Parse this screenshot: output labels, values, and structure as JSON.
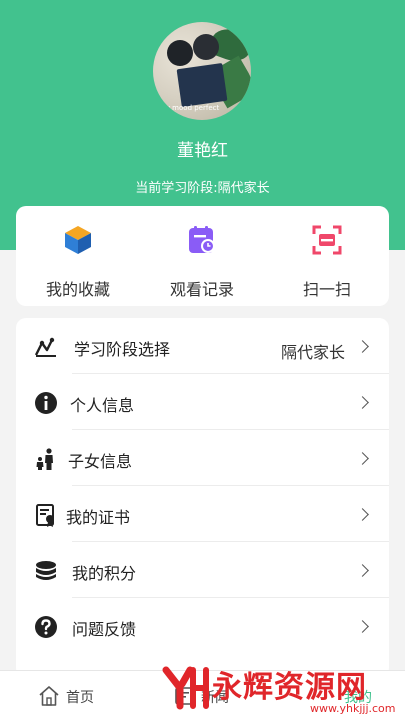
{
  "profile": {
    "avatar_caption": "my mood perfect",
    "name": "董艳红",
    "stage_text": "当前学习阶段:隔代家长"
  },
  "quick_actions": [
    {
      "label": "我的收藏",
      "icon": "cube-icon"
    },
    {
      "label": "观看记录",
      "icon": "history-icon"
    },
    {
      "label": "扫一扫",
      "icon": "scan-icon"
    }
  ],
  "menu": [
    {
      "label": "学习阶段选择",
      "value": "隔代家长",
      "icon": "stage-chart-icon"
    },
    {
      "label": "个人信息",
      "value": "",
      "icon": "info-icon"
    },
    {
      "label": "子女信息",
      "value": "",
      "icon": "family-icon"
    },
    {
      "label": "我的证书",
      "value": "",
      "icon": "certificate-icon"
    },
    {
      "label": "我的积分",
      "value": "",
      "icon": "coins-icon"
    },
    {
      "label": "问题反馈",
      "value": "",
      "icon": "question-icon"
    }
  ],
  "tabbar": {
    "home_label": "首页",
    "news_label": "新闻",
    "mine_label": "我的"
  },
  "watermark": {
    "text": "永辉资源网",
    "url": "www.yhkjjj.com"
  },
  "colors": {
    "header": "#42c28e",
    "favorite_icon": "#f5a623",
    "history_icon": "#8a5cf6",
    "scan_icon": "#f0476a",
    "watermark": "#e0262a"
  }
}
